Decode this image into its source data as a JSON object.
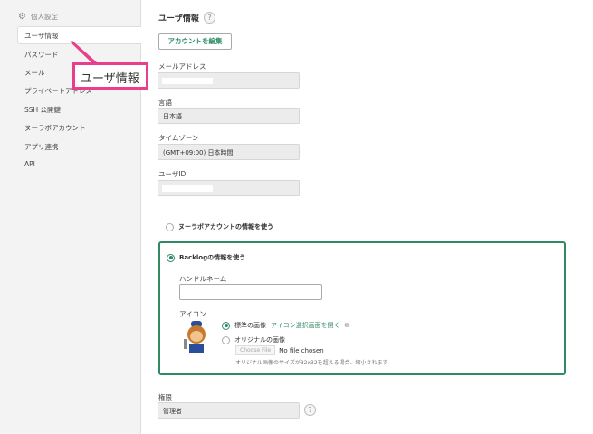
{
  "sidebar": {
    "section": "個人設定",
    "items": [
      {
        "label": "ユーザ情報"
      },
      {
        "label": "パスワード"
      },
      {
        "label": "メール"
      },
      {
        "label": "プライベートアドレス"
      },
      {
        "label": "SSH 公開鍵"
      },
      {
        "label": "ヌーラボアカウント"
      },
      {
        "label": "アプリ連携"
      },
      {
        "label": "API"
      }
    ]
  },
  "callout": {
    "text": "ユーザ情報",
    "color": "#e83e8c"
  },
  "main": {
    "title": "ユーザ情報",
    "help": "?",
    "edit_account": "アカウントを編集",
    "email": {
      "label": "メールアドレス",
      "value": ""
    },
    "language": {
      "label": "言語",
      "value": "日本語"
    },
    "timezone": {
      "label": "タイムゾーン",
      "value": "(GMT+09:00) 日本時間"
    },
    "user_id": {
      "label": "ユーザID",
      "value": ""
    },
    "use_nulab": "ヌーラボアカウントの情報を使う",
    "use_backlog": "Backlogの情報を使う",
    "handle": {
      "label": "ハンドルネーム",
      "value": ""
    },
    "icon": {
      "label": "アイコン",
      "standard": "標準の画像",
      "open_selector": "アイコン選択画面を開く",
      "original": "オリジナルの画像",
      "choose_file": "Choose File",
      "no_file": "No file chosen",
      "note": "オリジナル画像のサイズが32x32を超える場合、縮小されます"
    },
    "role": {
      "label": "権限",
      "value": "管理者"
    }
  },
  "accent": "#2f8a63"
}
